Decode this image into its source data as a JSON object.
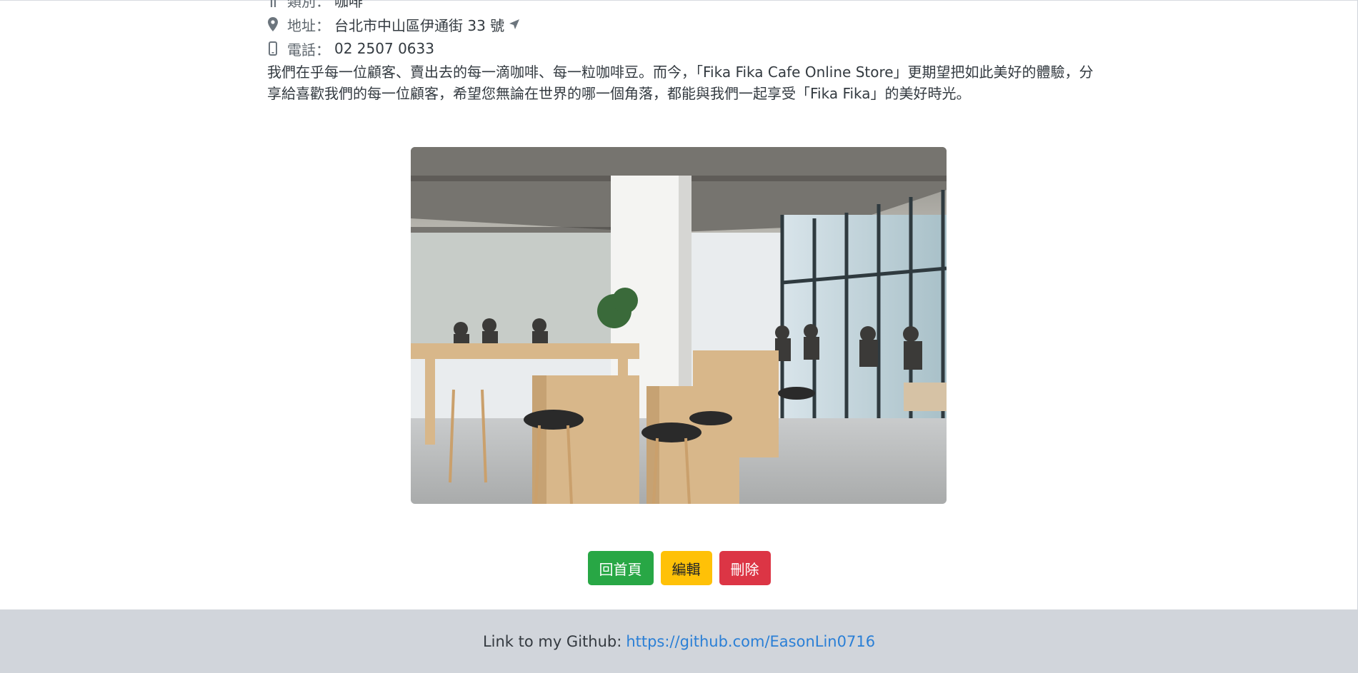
{
  "info": {
    "category": {
      "label": "類別：",
      "value": "咖啡"
    },
    "address": {
      "label": "地址：",
      "value": "台北市中山區伊通街 33 號"
    },
    "phone": {
      "label": "電話：",
      "value": "02 2507 0633"
    }
  },
  "description": "我們在乎每一位顧客、賣出去的每一滴咖啡、每一粒咖啡豆。而今，「Fika Fika Cafe Online Store」更期望把如此美好的體驗，分享給喜歡我們的每一位顧客，希望您無論在世界的哪一個角落，都能與我們一起享受「Fika Fika」的美好時光。",
  "buttons": {
    "home": "回首頁",
    "edit": "編輯",
    "delete": "刪除"
  },
  "colors": {
    "home": "#28a745",
    "edit": "#ffc107",
    "delete": "#dc3545",
    "link": "#2a7fd6",
    "footer_bg": "#d1d5db"
  },
  "footer": {
    "text": "Link to my Github:",
    "link": "https://github.com/EasonLin0716"
  }
}
